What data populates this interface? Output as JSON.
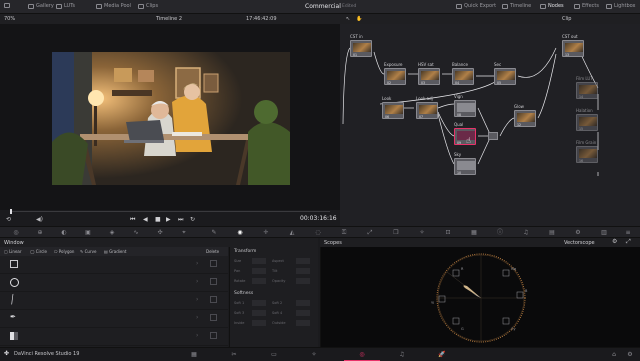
{
  "topbar": {
    "items_left": [
      "Gallery",
      "LUTs",
      "Media Pool",
      "Clips"
    ],
    "project_name": "Commercial",
    "project_state": "Edited",
    "items_right": [
      "Quick Export",
      "Timeline",
      "Nodes",
      "Effects",
      "Lightbox"
    ]
  },
  "viewer": {
    "zoom": "70%",
    "timeline_name": "Timeline 2",
    "source_timecode": "17:46:42:09",
    "duration_timecode": "00:03:16:16"
  },
  "nodes": {
    "mode": "Clip",
    "items": [
      {
        "label": "CST in",
        "num": "01"
      },
      {
        "label": "Exposure",
        "num": "02"
      },
      {
        "label": "HSV sat",
        "num": "03"
      },
      {
        "label": "Balance",
        "num": "04"
      },
      {
        "label": "Sec",
        "num": "05"
      },
      {
        "label": "Look",
        "num": "06"
      },
      {
        "label": "Look adj",
        "num": "07"
      },
      {
        "label": "Vign",
        "num": "08"
      },
      {
        "label": "Qual",
        "num": "09"
      },
      {
        "label": "Sky",
        "num": "10"
      },
      {
        "label": "Glow",
        "num": "12"
      },
      {
        "label": "CST out",
        "num": "13"
      },
      {
        "label": "Film LUT",
        "num": "14"
      },
      {
        "label": "Halation",
        "num": "15"
      },
      {
        "label": "Film Grain",
        "num": "16"
      }
    ]
  },
  "window_panel": {
    "title": "Window",
    "shape_tools": [
      "Linear",
      "Circle",
      "Polygon",
      "Curve",
      "Gradient"
    ],
    "delete_label": "Delete"
  },
  "transform": {
    "title": "Transform",
    "fields": [
      "Size",
      "Aspect",
      "Pan",
      "Tilt",
      "Rotate",
      "Opacity"
    ],
    "softness_title": "Softness",
    "soft_fields": [
      "Soft 1",
      "Soft 2",
      "Soft 3",
      "Soft 4",
      "Inside",
      "Outside"
    ]
  },
  "scopes": {
    "title": "Scopes",
    "scope_type": "Vectorscope",
    "targets": [
      "R",
      "Mg",
      "B",
      "Cy",
      "G",
      "Yl"
    ]
  },
  "app": {
    "name": "DaVinci Resolve Studio 19"
  },
  "colors": {
    "accent": "#e8336a",
    "node_connector": "#5fbf3a",
    "node_alpha_port": "#3aa3ff"
  }
}
